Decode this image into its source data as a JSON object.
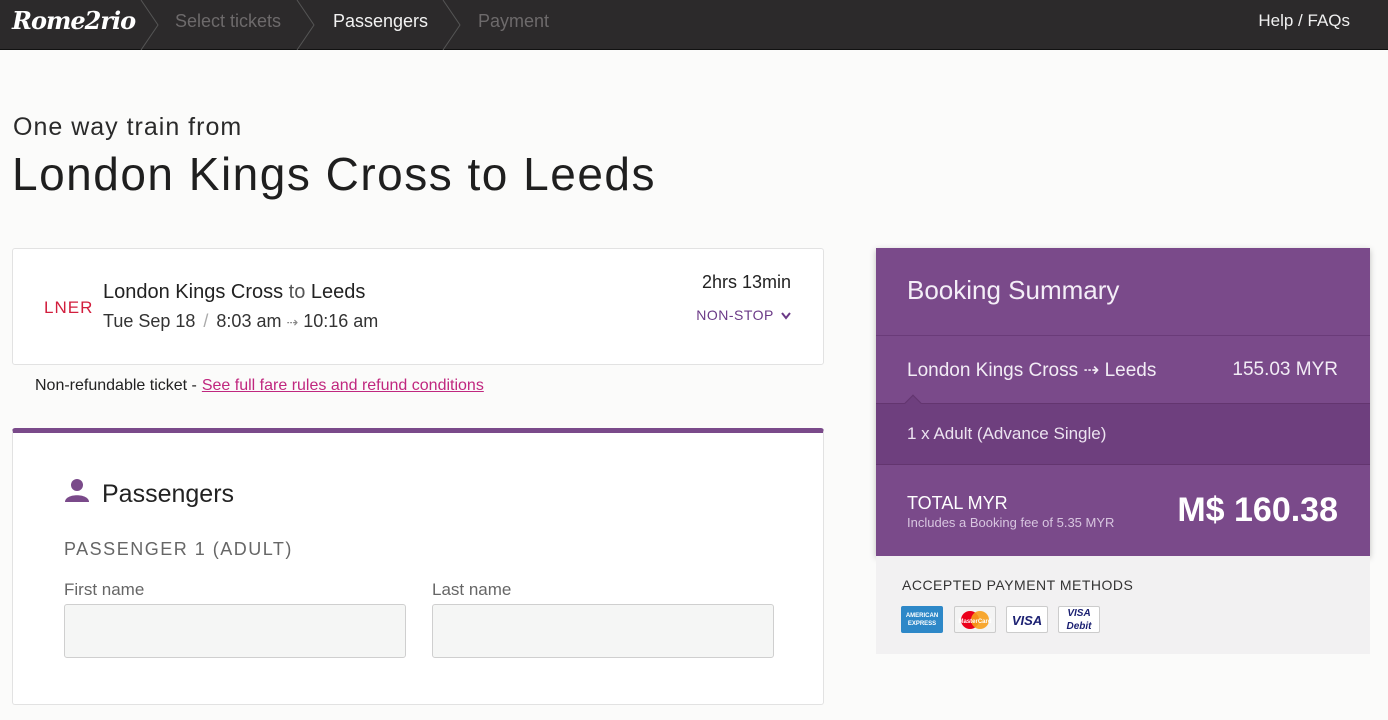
{
  "brand": {
    "logo_text": "Rome2rio"
  },
  "nav": {
    "steps": [
      "Select tickets",
      "Passengers",
      "Payment"
    ],
    "help_label": "Help / FAQs"
  },
  "heading": {
    "subtitle": "One way train from",
    "title": "London Kings Cross to Leeds"
  },
  "trip": {
    "operator_logo": "LNER",
    "origin": "London Kings Cross",
    "to_word": "to",
    "destination": "Leeds",
    "date": "Tue Sep 18",
    "depart": "8:03 am",
    "arrive": "10:16 am",
    "duration": "2hrs 13min",
    "stops_label": "NON-STOP"
  },
  "fare": {
    "note": "Non-refundable ticket -",
    "link": "See full fare rules and refund conditions"
  },
  "passengers": {
    "section_title": "Passengers",
    "passenger_heading": "PASSENGER 1 (ADULT)",
    "first_name_label": "First name",
    "last_name_label": "Last name",
    "first_name_value": "",
    "last_name_value": ""
  },
  "summary": {
    "title": "Booking Summary",
    "route": "London Kings Cross ⇢ Leeds",
    "route_price": "155.03 MYR",
    "passenger_line": "1 x Adult (Advance Single)",
    "total_label": "TOTAL MYR",
    "fee_note": "Includes a Booking fee of 5.35 MYR",
    "total_amount": "M$ 160.38",
    "accent_color": "#7a4a8a"
  },
  "payment": {
    "label": "ACCEPTED PAYMENT METHODS",
    "cards": [
      "AMERICAN EXPRESS",
      "MasterCard",
      "VISA",
      "VISA Debit"
    ]
  }
}
